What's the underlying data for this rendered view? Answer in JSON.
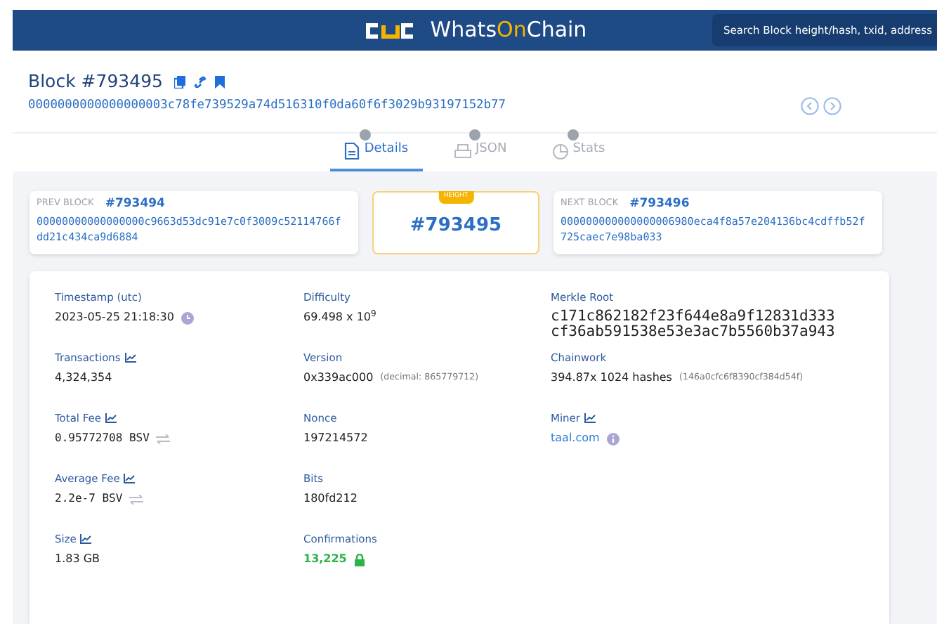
{
  "header": {
    "brand_prefix": "WhatsOn",
    "brand_suffix": "Chain",
    "search_placeholder": "Search Block height/hash, txid, address"
  },
  "block": {
    "title": "Block #793495",
    "hash": "0000000000000000003c78fe739529a74d516310f0da60f6f3029b93197152b77"
  },
  "tabs": [
    {
      "label": "Details",
      "selected": true,
      "kind": "details"
    },
    {
      "label": "JSON",
      "selected": false,
      "kind": "json"
    },
    {
      "label": "Stats",
      "selected": false,
      "kind": "stats"
    }
  ],
  "prev_block": {
    "label": "PREV BLOCK",
    "height": "#793494",
    "hash": "00000000000000000c9663d53dc91e7c0f3009c52114766fdd21c434ca9d6884"
  },
  "current": {
    "badge": "HEIGHT",
    "height": "#793495"
  },
  "next_block": {
    "label": "NEXT BLOCK",
    "height": "#793496",
    "hash": "000000000000000006980eca4f8a57e204136bc4cdffb52f725caec7e98ba033"
  },
  "columns": [
    {
      "fields": [
        {
          "label": "Timestamp (utc)",
          "value": "2023-05-25 21:18:30",
          "kind": "timestamp",
          "trend": false
        },
        {
          "label": "Transactions",
          "value": "4,324,354",
          "kind": "plain",
          "trend": true
        },
        {
          "label": "Total Fee",
          "value": "0.95772708 BSV",
          "kind": "amount",
          "trend": true
        },
        {
          "label": "Average Fee",
          "value": "2.2e-7 BSV",
          "kind": "amount",
          "trend": true
        },
        {
          "label": "Size",
          "value": "1.83 GB",
          "kind": "plain",
          "trend": true
        }
      ]
    },
    {
      "fields": [
        {
          "label": "Difficulty",
          "value": "69.498 x 10$^{9}$",
          "kind": "plain",
          "trend": false
        },
        {
          "label": "Version",
          "value": "0x339ac000",
          "note": "(decimal: 865779712)",
          "kind": "plain",
          "trend": false
        },
        {
          "label": "Nonce",
          "value": "197214572",
          "kind": "plain",
          "trend": false
        },
        {
          "label": "Bits",
          "value": "180fd212",
          "kind": "plain",
          "trend": false
        },
        {
          "label": "Confirmations",
          "value": "13,225",
          "kind": "confirmations",
          "trend": false
        }
      ]
    },
    {
      "fields": [
        {
          "label": "Merkle Root",
          "value": "c171c862182f23f644e8a9f12831d333cf36ab591538e53e3ac7b5560b37a943",
          "kind": "hash",
          "trend": false
        },
        {
          "label": "Chainwork",
          "value": "394.87x 1024 hashes",
          "note": "(146a0cfc6f8390cf384d54f)",
          "kind": "plain",
          "trend": false
        },
        {
          "label": "Miner",
          "value": "taal.com",
          "kind": "link",
          "trend": true
        }
      ]
    }
  ]
}
